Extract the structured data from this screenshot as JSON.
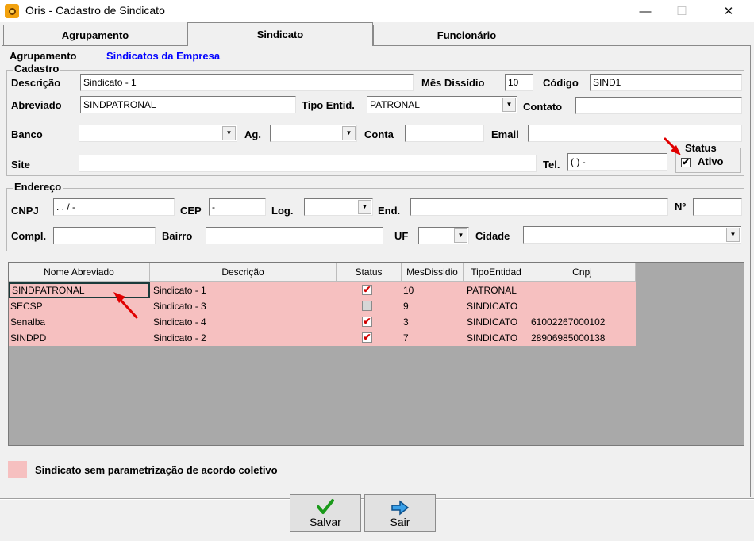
{
  "window": {
    "title": "Oris - Cadastro de Sindicato",
    "minimize": "—",
    "maximize": "☐",
    "close": "✕"
  },
  "tabs": [
    {
      "label": "Agrupamento"
    },
    {
      "label": "Sindicato"
    },
    {
      "label": "Funcionário"
    }
  ],
  "active_tab": "Sindicato",
  "agrupamento": {
    "label": "Agrupamento",
    "value": "Sindicatos da Empresa"
  },
  "cadastro": {
    "title": "Cadastro",
    "descricao_label": "Descrição",
    "descricao_value": "Sindicato - 1",
    "mes_label": "Mês Dissídio",
    "mes_value": "10",
    "codigo_label": "Código",
    "codigo_value": "SIND1",
    "abreviado_label": "Abreviado",
    "abreviado_value": "SINDPATRONAL",
    "tipo_label": "Tipo Entid.",
    "tipo_value": "PATRONAL",
    "contato_label": "Contato",
    "contato_value": "",
    "banco_label": "Banco",
    "banco_value": "",
    "ag_label": "Ag.",
    "ag_value": "",
    "conta_label": "Conta",
    "conta_value": "",
    "email_label": "Email",
    "email_value": "",
    "site_label": "Site",
    "site_value": "",
    "tel_label": "Tel.",
    "tel_value": "( )   -",
    "status_title": "Status",
    "ativo_label": "Ativo",
    "ativo_checked": true
  },
  "endereco": {
    "title": "Endereço",
    "cnpj_label": "CNPJ",
    "cnpj_value": "  .   .   /    -",
    "cep_label": "CEP",
    "cep_value": "     -",
    "log_label": "Log.",
    "log_value": "",
    "end_label": "End.",
    "end_value": "",
    "num_label": "Nº",
    "num_value": "",
    "compl_label": "Compl.",
    "compl_value": "",
    "bairro_label": "Bairro",
    "bairro_value": "",
    "uf_label": "UF",
    "uf_value": "",
    "cidade_label": "Cidade",
    "cidade_value": ""
  },
  "grid": {
    "columns": [
      "Nome Abreviado",
      "Descrição",
      "Status",
      "MesDissidio",
      "TipoEntidad",
      "Cnpj"
    ],
    "rows": [
      {
        "nome": "SINDPATRONAL",
        "descricao": "Sindicato - 1",
        "status": true,
        "mes": "10",
        "tipo": "PATRONAL",
        "cnpj": ""
      },
      {
        "nome": "SECSP",
        "descricao": "Sindicato - 3",
        "status": false,
        "mes": "9",
        "tipo": "SINDICATO",
        "cnpj": ""
      },
      {
        "nome": "Senalba",
        "descricao": "Sindicato - 4",
        "status": true,
        "mes": "3",
        "tipo": "SINDICATO",
        "cnpj": "61002267000102"
      },
      {
        "nome": "SINDPD",
        "descricao": "Sindicato - 2",
        "status": true,
        "mes": "7",
        "tipo": "SINDICATO",
        "cnpj": "28906985000138"
      }
    ],
    "row_color": "#f6c0c0"
  },
  "legend": {
    "text": "Sindicato sem parametrização de acordo coletivo",
    "color": "#f6c0c0"
  },
  "buttons": {
    "salvar": "Salvar",
    "sair": "Sair"
  },
  "annotation_color": "#e00000"
}
